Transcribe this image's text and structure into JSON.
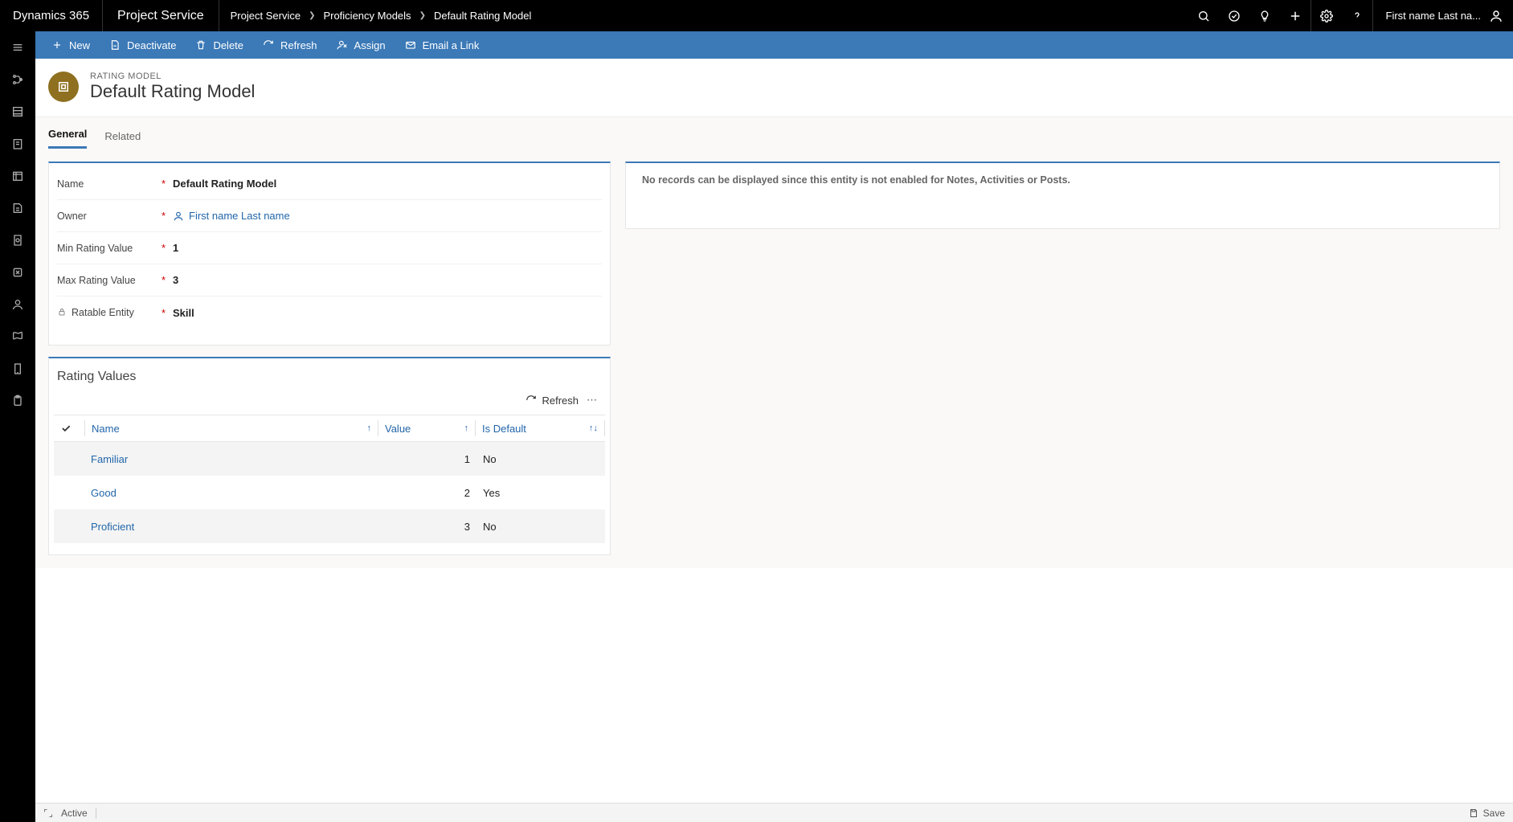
{
  "topbar": {
    "brand": "Dynamics 365",
    "app": "Project Service",
    "breadcrumbs": [
      "Project Service",
      "Proficiency Models",
      "Default Rating Model"
    ],
    "user_name": "First name Last na..."
  },
  "cmdbar": {
    "new": "New",
    "deactivate": "Deactivate",
    "delete": "Delete",
    "refresh": "Refresh",
    "assign": "Assign",
    "email": "Email a Link"
  },
  "header": {
    "eyebrow": "RATING MODEL",
    "title": "Default Rating Model"
  },
  "tabs": {
    "general": "General",
    "related": "Related"
  },
  "form": {
    "name": {
      "label": "Name",
      "value": "Default Rating Model"
    },
    "owner": {
      "label": "Owner",
      "value": "First name Last name"
    },
    "min": {
      "label": "Min Rating Value",
      "value": "1"
    },
    "max": {
      "label": "Max Rating Value",
      "value": "3"
    },
    "ratable": {
      "label": "Ratable Entity",
      "value": "Skill"
    }
  },
  "notes_message": "No records can be displayed since this entity is not enabled for Notes, Activities or Posts.",
  "rating_values": {
    "title": "Rating Values",
    "refresh": "Refresh",
    "columns": {
      "name": "Name",
      "value": "Value",
      "is_default": "Is Default"
    },
    "rows": [
      {
        "name": "Familiar",
        "value": "1",
        "is_default": "No"
      },
      {
        "name": "Good",
        "value": "2",
        "is_default": "Yes"
      },
      {
        "name": "Proficient",
        "value": "3",
        "is_default": "No"
      }
    ]
  },
  "status": {
    "state": "Active",
    "save": "Save"
  }
}
